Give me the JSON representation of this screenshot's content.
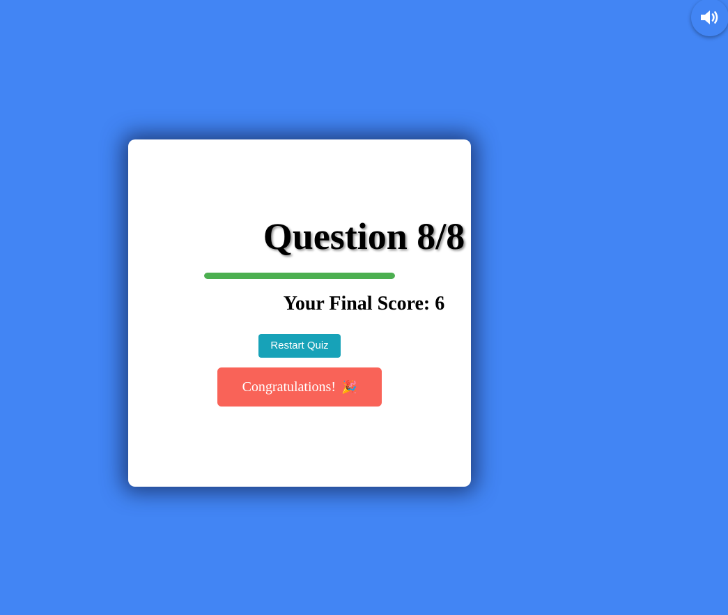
{
  "header": {
    "sound_icon": "volume-up-icon"
  },
  "quiz": {
    "title": "Question 8/8",
    "progress_fraction": 1.0,
    "progress_color": "#4caf50",
    "final_score_text": "Your Final Score: 6",
    "restart_label": "Restart Quiz",
    "congrats_text": "Congratulations!",
    "congrats_emoji": "🎉",
    "congrats_color": "#f96358",
    "restart_color": "#17a2b8"
  },
  "theme": {
    "background": "#4285f4",
    "card": "#ffffff"
  }
}
